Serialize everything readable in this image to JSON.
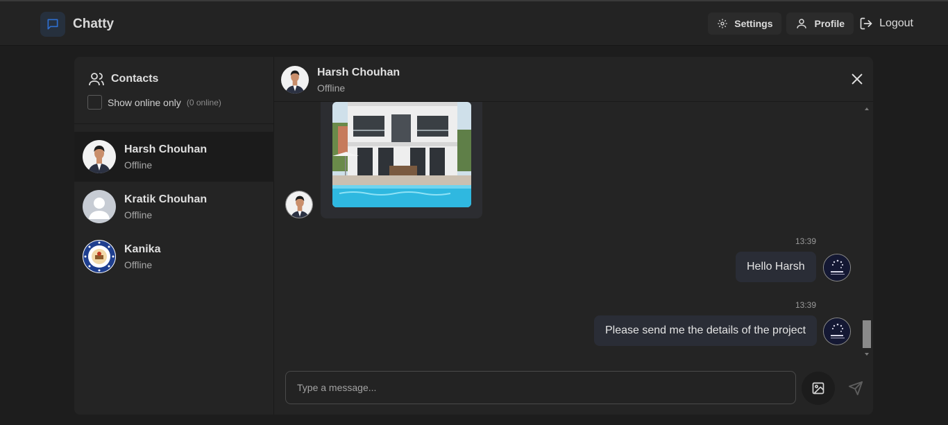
{
  "app": {
    "title": "Chatty",
    "icon": "chat-bubble-icon",
    "accent": "#3b82f6"
  },
  "nav": {
    "settings_label": "Settings",
    "profile_label": "Profile",
    "logout_label": "Logout"
  },
  "sidebar": {
    "title": "Contacts",
    "filter_label": "Show online only",
    "online_count": "(0 online)",
    "contacts": [
      {
        "name": "Harsh Chouhan",
        "status": "Offline",
        "avatar": "photo-avatar"
      },
      {
        "name": "Kratik Chouhan",
        "status": "Offline",
        "avatar": "default-avatar"
      },
      {
        "name": "Kanika",
        "status": "Offline",
        "avatar": "emblem-avatar"
      }
    ]
  },
  "chat": {
    "contact_name": "Harsh Chouhan",
    "contact_status": "Offline",
    "messages": [
      {
        "from": "contact",
        "type": "image",
        "image": "house-with-pool"
      },
      {
        "from": "me",
        "time": "13:39",
        "text": "Hello Harsh"
      },
      {
        "from": "me",
        "time": "13:39",
        "text": "Please send me the details of the project"
      }
    ],
    "input_placeholder": "Type a message..."
  }
}
